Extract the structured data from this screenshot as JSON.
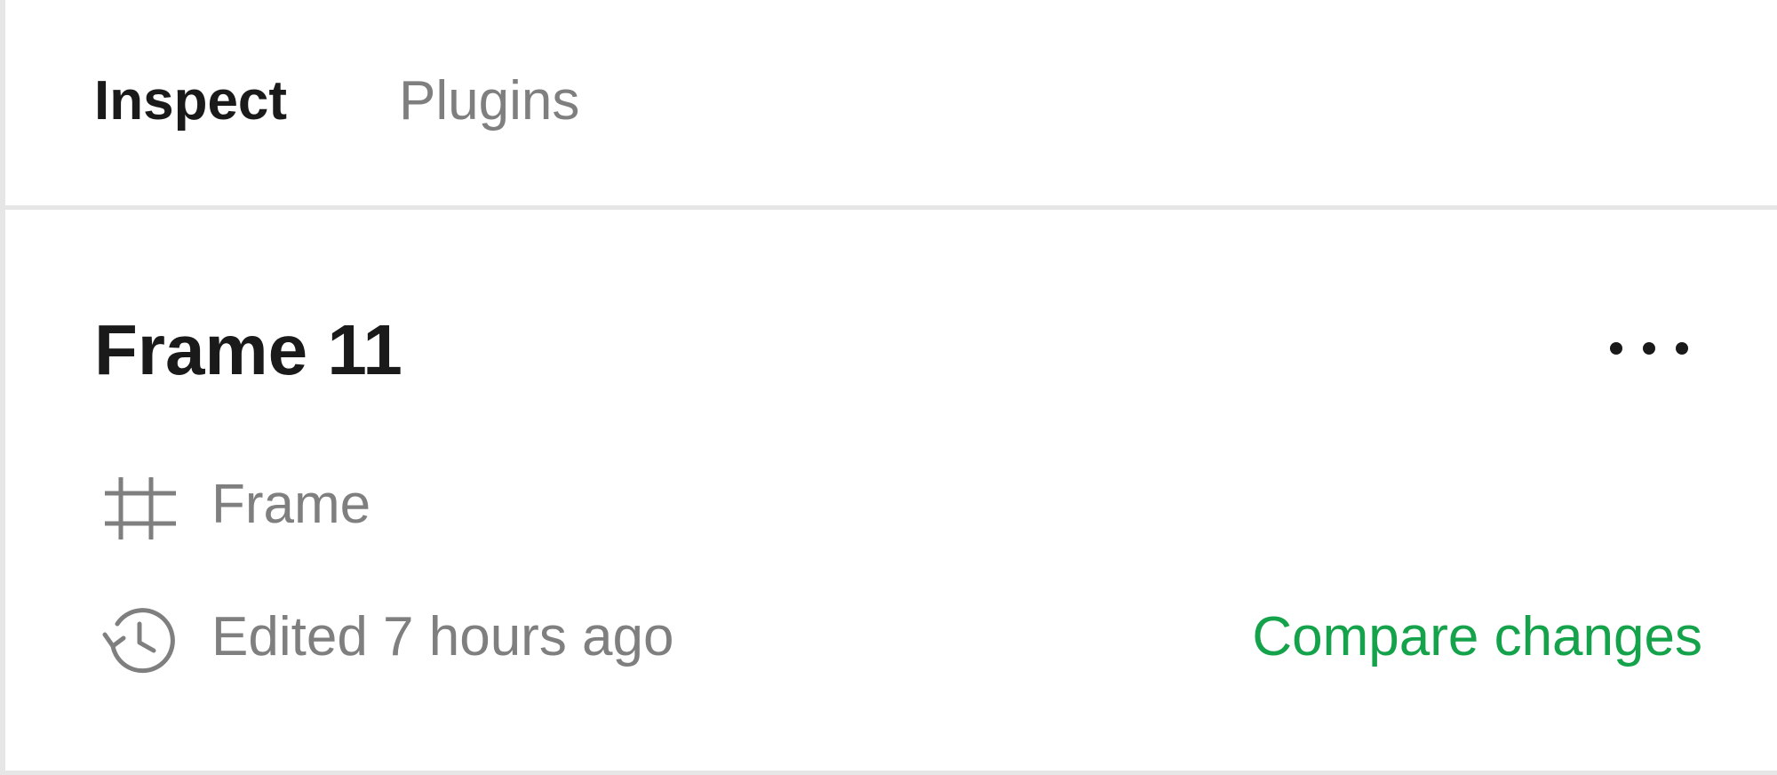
{
  "tabs": [
    {
      "label": "Inspect",
      "active": true
    },
    {
      "label": "Plugins",
      "active": false
    }
  ],
  "selection": {
    "title": "Frame 11",
    "type_icon": "frame-hash-icon",
    "type_label": "Frame",
    "history_icon": "history-icon",
    "edited_label": "Edited 7 hours ago",
    "compare_label": "Compare changes",
    "more_icon": "more-horizontal-icon"
  },
  "colors": {
    "accent_green": "#14a24a",
    "text_primary": "#1a1a1a",
    "text_secondary": "#7f7f7f",
    "divider": "#e6e6e6"
  }
}
